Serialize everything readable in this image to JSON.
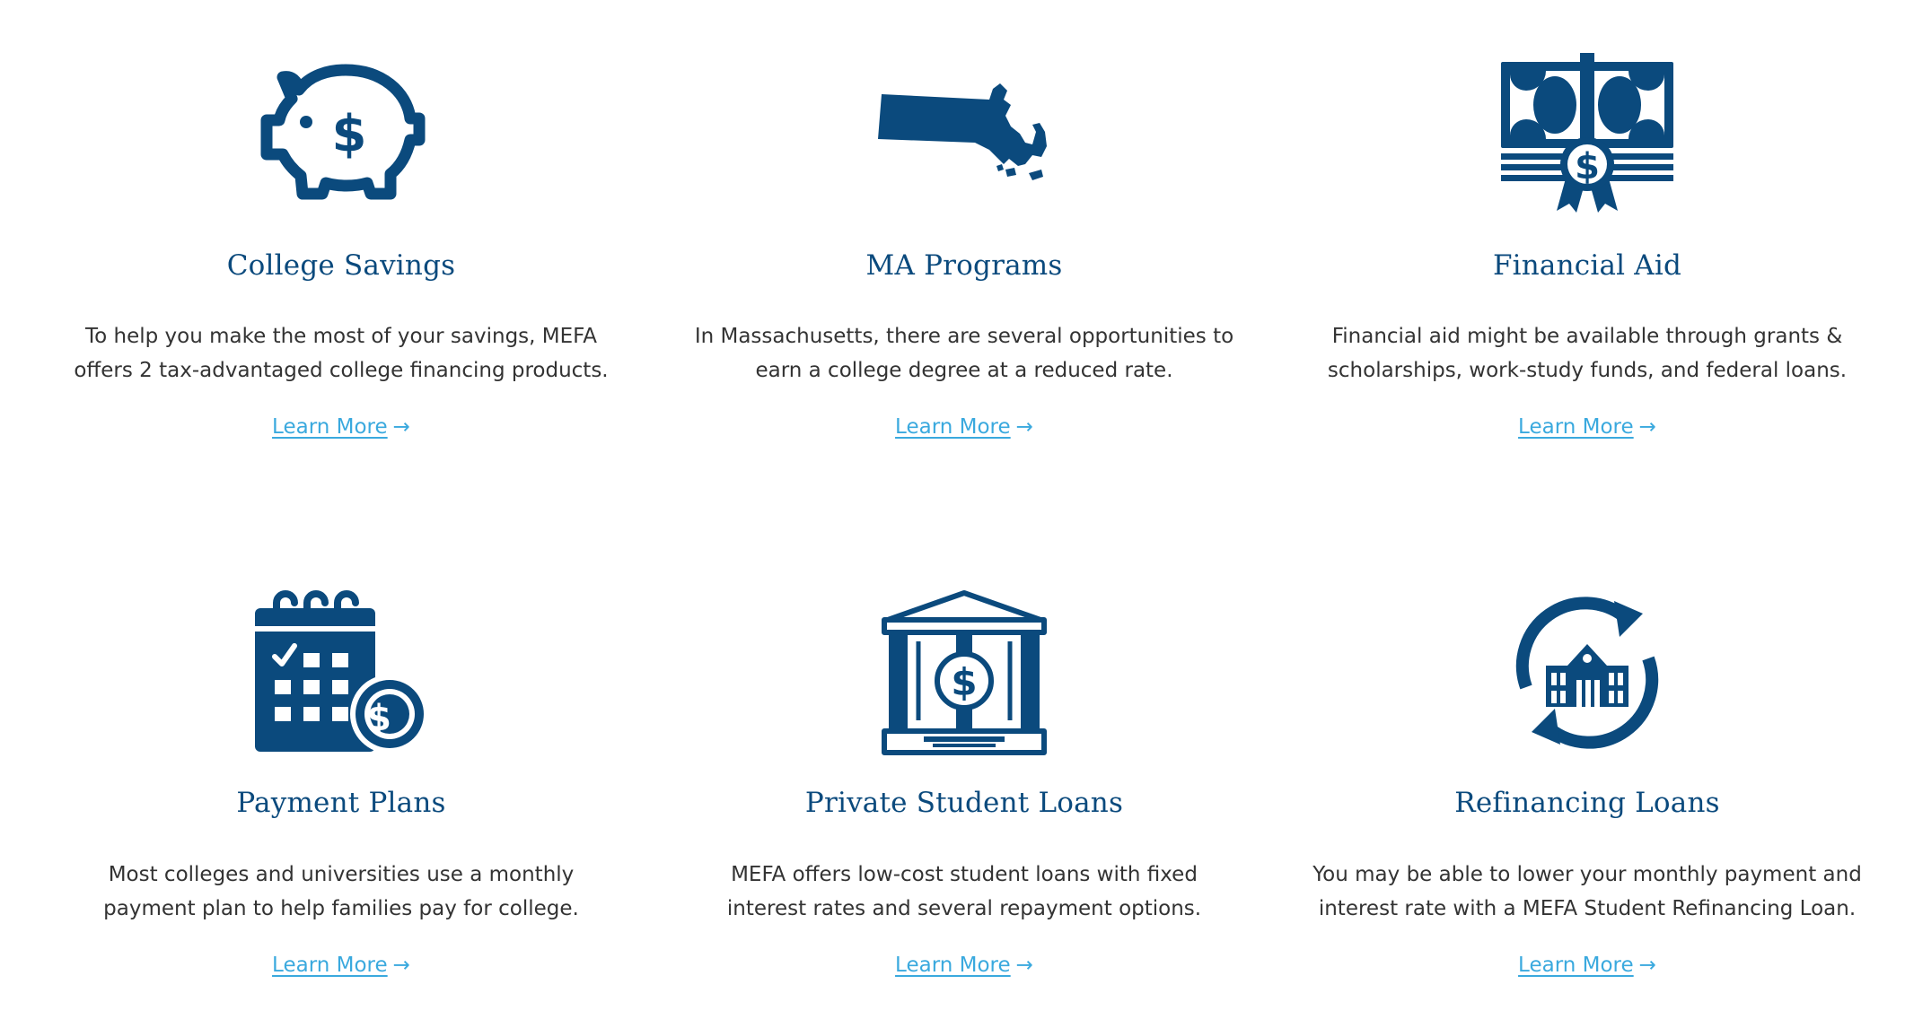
{
  "colors": {
    "icon_navy": "#0b4a7d",
    "title_navy": "#0b4a7d",
    "body_text": "#333333",
    "link_blue": "#3aa9de"
  },
  "cards": [
    {
      "icon": "piggy-bank-icon",
      "title": "College Savings",
      "desc_line1": "To help you make the most of your savings, MEFA",
      "desc_line2": "offers 2 tax-advantaged college financing products.",
      "link": "Learn More",
      "arrow": "→"
    },
    {
      "icon": "massachusetts-map-icon",
      "title": "MA Programs",
      "desc_line1": "In Massachusetts, there are several opportunities to",
      "desc_line2": "earn a college degree at a reduced rate.",
      "link": "Learn More",
      "arrow": "→"
    },
    {
      "icon": "money-diploma-icon",
      "title": "Financial Aid",
      "desc_line1": "Financial aid might be available through grants &",
      "desc_line2": "scholarships, work-study funds, and federal loans.",
      "link": "Learn More",
      "arrow": "→"
    },
    {
      "icon": "calendar-coin-icon",
      "title": "Payment Plans",
      "desc_line1": "Most colleges and universities use a monthly",
      "desc_line2": "payment plan to help families pay for college.",
      "link": "Learn More",
      "arrow": "→"
    },
    {
      "icon": "bank-building-icon",
      "title": "Private Student Loans",
      "desc_line1": "MEFA offers low-cost student loans with fixed",
      "desc_line2": "interest rates and several repayment options.",
      "link": "Learn More",
      "arrow": "→"
    },
    {
      "icon": "refinance-cycle-icon",
      "title": "Refinancing Loans",
      "desc_line1": "You may be able to lower your monthly payment and",
      "desc_line2": "interest rate with a MEFA Student Refinancing Loan.",
      "link": "Learn More",
      "arrow": "→"
    }
  ]
}
